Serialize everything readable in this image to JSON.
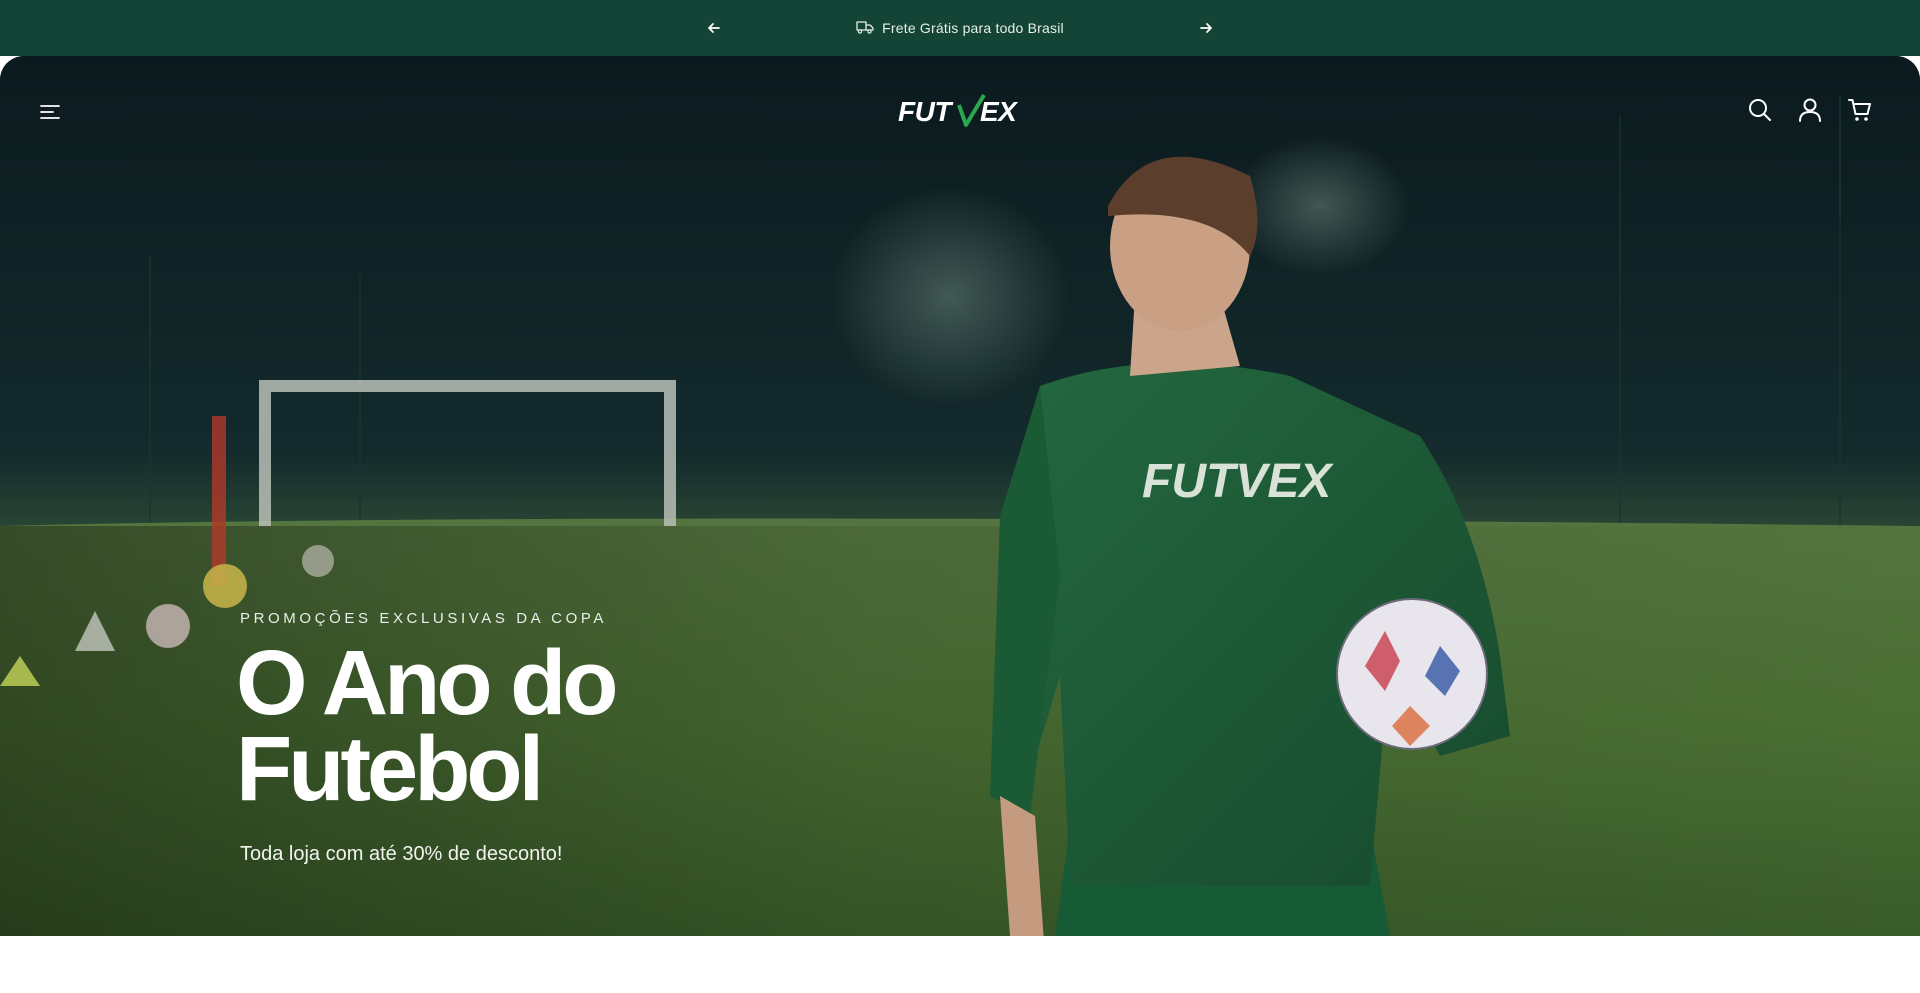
{
  "announcement": {
    "text": "Frete Grátis para todo Brasil",
    "icon": "truck-icon"
  },
  "header": {
    "logo_text": "FUTVEX",
    "icons": [
      "menu-icon",
      "search-icon",
      "account-icon",
      "cart-icon"
    ]
  },
  "hero": {
    "eyebrow": "PROMOÇÕES EXCLUSIVAS DA COPA",
    "headline_line1": "O Ano do",
    "headline_line2": "Futebol",
    "subtext": "Toda loja com até 30% de desconto!",
    "jersey_text": "FUTVEX"
  },
  "colors": {
    "announcement_bg": "#134436",
    "accent_green": "#1f7a3e",
    "jersey_green": "#1c5a37",
    "white": "#ffffff"
  }
}
